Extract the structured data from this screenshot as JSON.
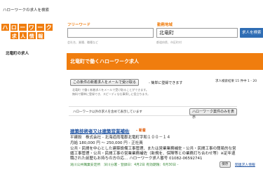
{
  "header": {
    "title": "ハローワークの求人を検索"
  },
  "logo": {
    "row1": [
      "ハ",
      "ロ",
      "ー",
      "ワ",
      "ー",
      "ク"
    ],
    "row2": [
      "求",
      "人",
      "情",
      "報"
    ]
  },
  "sidebar": {
    "heading": "北竜町の求人"
  },
  "search": {
    "free_label": "フリーワード",
    "area_label": "勤務地域",
    "free_value": "",
    "area_value": "北竜町",
    "button_label": "求人を検索",
    "free_hint": "会社名、業種、職種など",
    "area_hint": "都道府県、市区町村"
  },
  "banner": {
    "title": "北竜町で働くハローワーク求人"
  },
  "alert": {
    "button_label": "この条件の新着求人をメールで受け取る",
    "suffix": "- 簡単に登録できます",
    "result_count": "求人検索結果 15 件中 1 - 20",
    "desc1": "北竜町 で働く新着求人をメールで受け取ることができます。",
    "desc2": "無料で簡単に登録でき、スピーディな仕事探しに役立ちます。"
  },
  "other": {
    "text": "ハローワーク以外の求人を含めて表示しています",
    "button_label": "ハローワーク案件のみを表示"
  },
  "job": {
    "title": "建築技術者又は建築営業補佐",
    "new_badge": "- 新着",
    "company": "平建設　株式会社 - 北海道雨竜郡北竜町字和１００－１４",
    "salary": "月給 180,000 円 ～ 250,000 円 - 正社員",
    "desc1": "公共・民間を中心とした建築設備工事管理、または営業業務補佐・公共・民間工事の簡易的な営",
    "desc2": "繕工事管理・公共・民間工事の営業業務補佐（新規を、保険等との業務打ち合わせ等）※定年退",
    "desc3": "職された前歴もお持ちの方の応… ハローワーク求人番号 01082-06592741",
    "footer": "滝川公共職業安定所　深川分署 - 登録日：4月2日  有効期限：6月30日 -",
    "save_label": "保存",
    "related_link": "関連求人情報"
  }
}
